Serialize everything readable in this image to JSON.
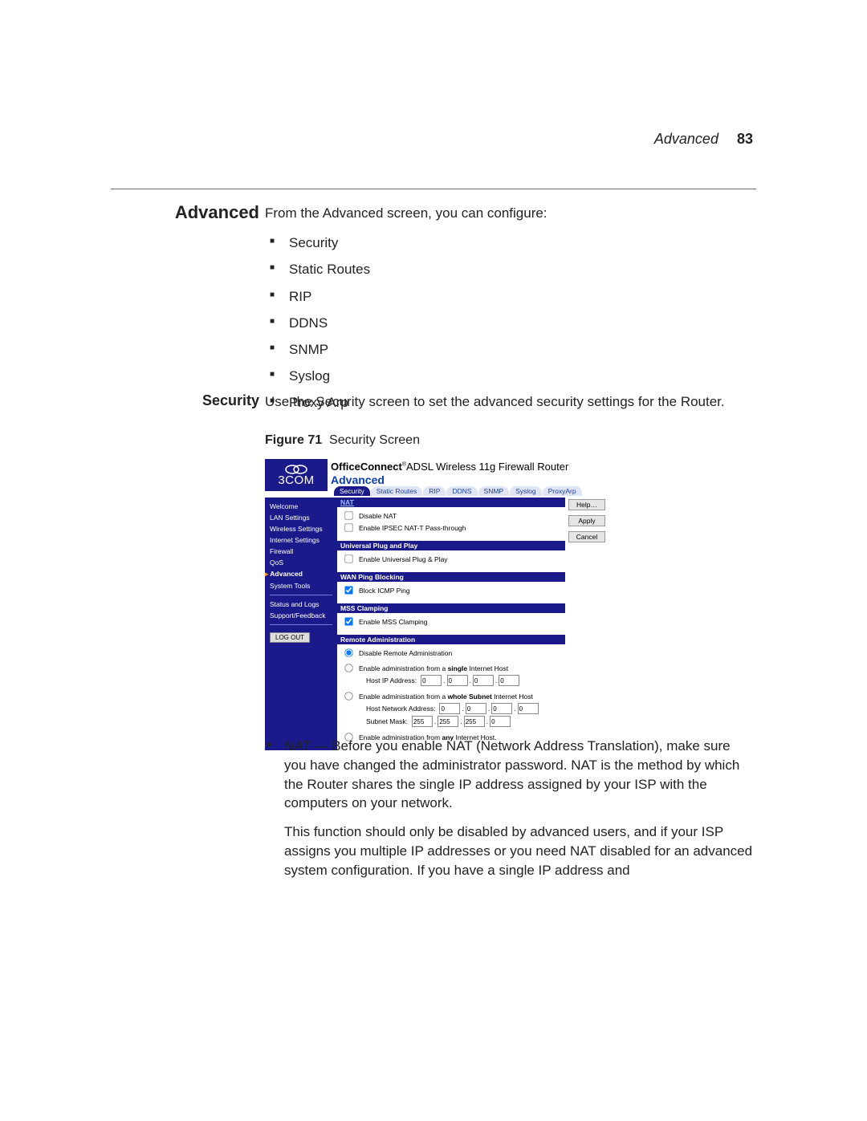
{
  "header": {
    "section": "Advanced",
    "page": "83"
  },
  "h1": "Advanced",
  "intro": "From the Advanced screen, you can configure:",
  "bullets": [
    "Security",
    "Static Routes",
    "RIP",
    "DDNS",
    "SNMP",
    "Syslog",
    "Proxy Arp"
  ],
  "h2": "Security",
  "sec_text": "Use the Security screen to set the advanced security settings for the Router.",
  "fig": {
    "label": "Figure 71",
    "caption": "Security Screen"
  },
  "shot": {
    "brand": "3COM",
    "product_bold": "OfficeConnect",
    "product_rest": "ADSL Wireless 11g Firewall Router",
    "title": "Advanced",
    "tabs": [
      "Security",
      "Static Routes",
      "RIP",
      "DDNS",
      "SNMP",
      "Syslog",
      "ProxyArp"
    ],
    "side": [
      "Welcome",
      "LAN Settings",
      "Wireless Settings",
      "Internet Settings",
      "Firewall",
      "QoS",
      "Advanced",
      "System Tools"
    ],
    "side2": [
      "Status and Logs",
      "Support/Feedback"
    ],
    "logout": "LOG OUT",
    "btns": {
      "help": "Help…",
      "apply": "Apply",
      "cancel": "Cancel"
    },
    "nat": {
      "head": "NAT",
      "l1": "Disable NAT",
      "l2": "Enable IPSEC NAT-T Pass-through"
    },
    "upnp": {
      "head": "Universal Plug and Play",
      "l1": "Enable Universal Plug & Play"
    },
    "wan": {
      "head": "WAN Ping Blocking",
      "l1": "Block ICMP Ping"
    },
    "mss": {
      "head": "MSS Clamping",
      "l1": "Enable MSS Clamping"
    },
    "ra": {
      "head": "Remote Administration",
      "o1": "Disable Remote Administration",
      "o2": "Enable administration from a single Internet Host",
      "o2b": "single",
      "hip": "Host IP Address:",
      "o3": "Enable administration from a whole Subnet Internet Host",
      "o3b": "whole Subnet",
      "hna": "Host Network Address:",
      "sm": "Subnet Mask:",
      "o4": "Enable administration from any Internet Host.",
      "o4b": "any",
      "ip0": "0",
      "m255": "255"
    }
  },
  "after": {
    "nat_lead": "NAT",
    "p1": " — Before you enable NAT (Network Address Translation), make sure you have changed the administrator password. NAT is the method by which the Router shares the single IP address assigned by your ISP with the computers on your network.",
    "p2": "This function should only be disabled by advanced users, and if your ISP assigns you multiple IP addresses or you need NAT disabled for an advanced system configuration. If you have a single IP address and"
  }
}
